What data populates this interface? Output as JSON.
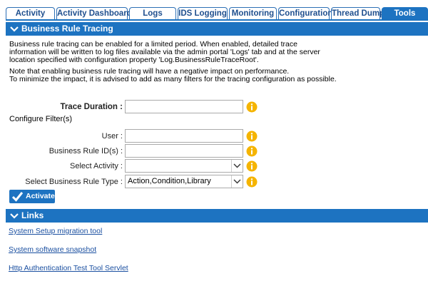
{
  "tabs": [
    {
      "label": "Activity"
    },
    {
      "label": "Activity Dashboards"
    },
    {
      "label": "Logs"
    },
    {
      "label": "IDS Logging"
    },
    {
      "label": "Monitoring"
    },
    {
      "label": "Configuration"
    },
    {
      "label": "Thread Dump"
    },
    {
      "label": "Tools",
      "active": true
    }
  ],
  "tracing": {
    "header": "Business Rule Tracing",
    "description_lines": [
      "Business rule tracing can be enabled for a limited period. When enabled, detailed trace",
      "information will be written to log files available via the admin portal 'Logs' tab and at the server",
      "location specified with configuration property 'Log.BusinessRuleTraceRoot'."
    ],
    "note_lines": [
      "Note that enabling business rule tracing will have a negative impact on performance.",
      "To minimize the impact, it is advised to add as many filters for the tracing configuration as possible."
    ],
    "trace_duration_label": "Trace Duration :",
    "trace_duration_value": "",
    "configure_filters_label": "Configure Filter(s)",
    "user_label": "User :",
    "user_value": "",
    "rule_ids_label": "Business Rule ID(s) :",
    "rule_ids_value": "",
    "activity_label": "Select Activity :",
    "activity_value": "",
    "rule_type_label": "Select Business Rule Type :",
    "rule_type_value": "Action,Condition,Library",
    "activate_label": "Activate"
  },
  "links": {
    "header": "Links",
    "items": [
      "System Setup migration tool",
      "System software snapshot",
      "Http Authentication Test Tool Servlet"
    ]
  },
  "colors": {
    "accent": "#1d73c1",
    "info_icon": "#f5b400",
    "link": "#1a4fa0"
  }
}
